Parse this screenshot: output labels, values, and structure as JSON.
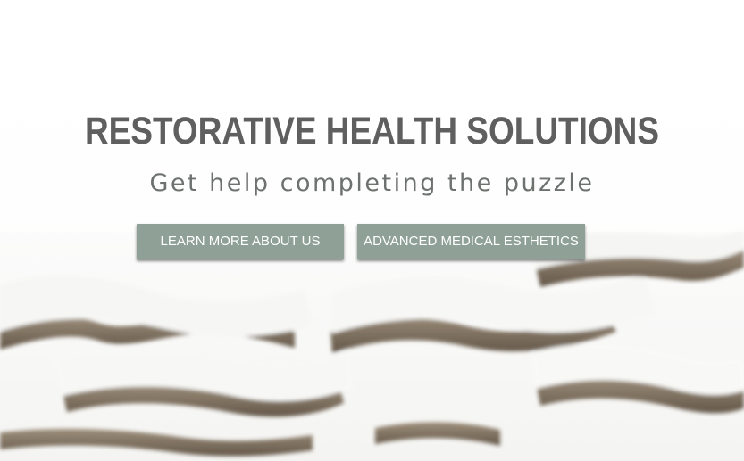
{
  "hero": {
    "title": "RESTORATIVE HEALTH SOLUTIONS",
    "subtitle": "Get help completing the puzzle",
    "background_image": "puzzle-pieces",
    "buttons": {
      "learn_more": "LEARN MORE ABOUT US",
      "medical_esthetics": "ADVANCED MEDICAL ESTHETICS"
    }
  },
  "colors": {
    "title": "#5f5f5f",
    "subtitle": "#6e726f",
    "button_bg": "#8fa196",
    "button_text": "#ffffff"
  }
}
